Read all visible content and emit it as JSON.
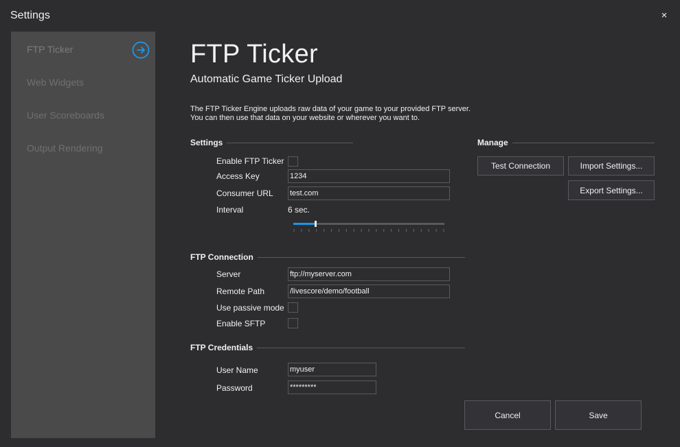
{
  "window": {
    "title": "Settings",
    "close_glyph": "×"
  },
  "sidebar": {
    "items": [
      {
        "label": "FTP Ticker",
        "active": true
      },
      {
        "label": "Web Widgets"
      },
      {
        "label": "User Scoreboards"
      },
      {
        "label": "Output Rendering"
      }
    ],
    "active_icon": "arrow-circle-right-icon",
    "accent": "#1c97ea"
  },
  "header": {
    "title": "FTP Ticker",
    "subtitle": "Automatic Game Ticker Upload",
    "description_line1": "The FTP Ticker Engine uploads raw data of your game to your provided FTP server.",
    "description_line2": "You can then use that data on your website or wherever you want to."
  },
  "settings": {
    "header": "Settings",
    "enable_label": "Enable FTP Ticker",
    "enable_checked": false,
    "access_key_label": "Access Key",
    "access_key_value": "1234",
    "consumer_url_label": "Consumer URL",
    "consumer_url_value": "test.com",
    "interval_label": "Interval",
    "interval_value": "6 sec.",
    "interval_slider_fraction": 0.145
  },
  "manage": {
    "header": "Manage",
    "test_connection": "Test Connection",
    "import_settings": "Import Settings...",
    "export_settings": "Export Settings..."
  },
  "ftp_connection": {
    "header": "FTP Connection",
    "server_label": "Server",
    "server_value": "ftp://myserver.com",
    "remote_path_label": "Remote Path",
    "remote_path_value": "/livescore/demo/football",
    "passive_label": "Use passive mode",
    "passive_checked": false,
    "sftp_label": "Enable SFTP",
    "sftp_checked": false
  },
  "ftp_credentials": {
    "header": "FTP Credentials",
    "username_label": "User Name",
    "username_value": "myuser",
    "password_label": "Password",
    "password_value": "*********"
  },
  "footer": {
    "cancel": "Cancel",
    "save": "Save"
  }
}
